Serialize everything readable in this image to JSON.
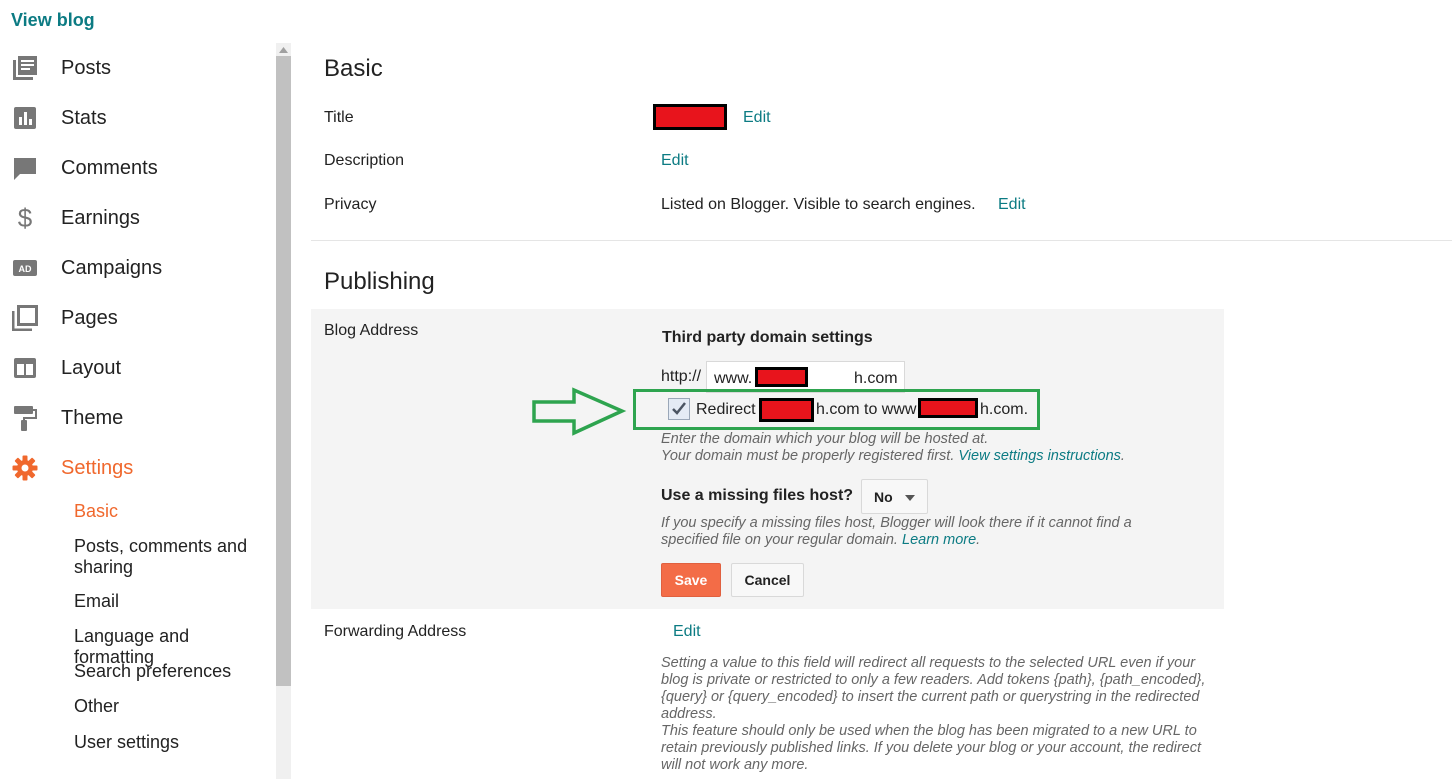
{
  "sidebar": {
    "view_blog": "View blog",
    "items": [
      {
        "label": "Posts",
        "icon": "posts-icon"
      },
      {
        "label": "Stats",
        "icon": "stats-icon"
      },
      {
        "label": "Comments",
        "icon": "comments-icon"
      },
      {
        "label": "Earnings",
        "icon": "dollar-icon"
      },
      {
        "label": "Campaigns",
        "icon": "ad-icon"
      },
      {
        "label": "Pages",
        "icon": "pages-icon"
      },
      {
        "label": "Layout",
        "icon": "layout-icon"
      },
      {
        "label": "Theme",
        "icon": "paint-roller-icon"
      },
      {
        "label": "Settings",
        "icon": "gear-icon"
      }
    ],
    "sub_items": [
      {
        "label": "Basic"
      },
      {
        "label": "Posts, comments and sharing"
      },
      {
        "label": "Email"
      },
      {
        "label": "Language and formatting"
      },
      {
        "label": "Search preferences"
      },
      {
        "label": "Other"
      },
      {
        "label": "User settings"
      }
    ]
  },
  "basic": {
    "title": "Basic",
    "title_label": "Title",
    "description_label": "Description",
    "privacy_label": "Privacy",
    "privacy_value": "Listed on Blogger. Visible to search engines.",
    "edit": "Edit"
  },
  "publishing": {
    "title": "Publishing",
    "blog_address_label": "Blog Address",
    "third_party_heading": "Third party domain settings",
    "http_prefix": "http://",
    "domain_prefix": "www.",
    "domain_suffix": "h.com",
    "redirect_label_a": "Redirect",
    "redirect_label_b": "h.com to www",
    "redirect_label_c": "h.com.",
    "redirect_checked": true,
    "help_line1": "Enter the domain which your blog will be hosted at.",
    "help_line2": "Your domain must be properly registered first.",
    "help_link": "View settings instructions",
    "help_end": ".",
    "missing_files_label": "Use a missing files host?",
    "missing_files_value": "No",
    "missing_help": "If you specify a missing files host, Blogger will look there if it cannot find a specified file on your regular domain.",
    "learn_more": "Learn more",
    "save": "Save",
    "cancel": "Cancel",
    "forwarding_label": "Forwarding Address",
    "forwarding_edit": "Edit",
    "forwarding_help1": "Setting a value to this field will redirect all requests to the selected URL even if your blog is private or restricted to only a few readers. Add tokens {path}, {path_encoded}, {query} or {query_encoded} to insert the current path or querystring in the redirected address.",
    "forwarding_help2": "This feature should only be used when the blog has been migrated to a new URL to retain previously published links. If you delete your blog or your account, the redirect will not work any more."
  },
  "colors": {
    "accent": "#f0682d",
    "link": "#0c7b83",
    "highlight": "#2ea44f",
    "redaction": "#e8141c"
  }
}
